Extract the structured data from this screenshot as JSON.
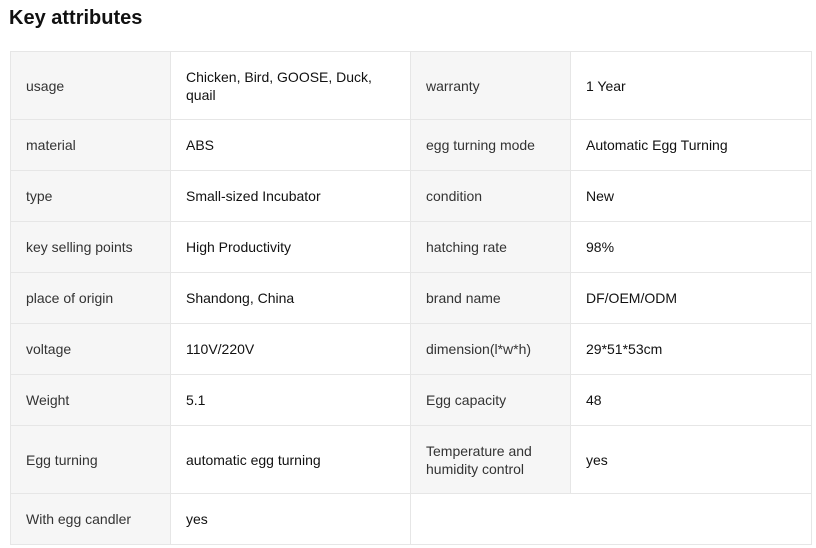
{
  "title": "Key attributes",
  "rows": [
    [
      {
        "k": "usage",
        "v": "Chicken, Bird, GOOSE, Duck, quail"
      },
      {
        "k": "warranty",
        "v": "1 Year"
      }
    ],
    [
      {
        "k": "material",
        "v": "ABS"
      },
      {
        "k": "egg turning mode",
        "v": "Automatic Egg Turning"
      }
    ],
    [
      {
        "k": "type",
        "v": "Small-sized Incubator"
      },
      {
        "k": "condition",
        "v": "New"
      }
    ],
    [
      {
        "k": "key selling points",
        "v": "High Productivity"
      },
      {
        "k": "hatching rate",
        "v": "98%"
      }
    ],
    [
      {
        "k": "place of origin",
        "v": "Shandong, China"
      },
      {
        "k": "brand name",
        "v": "DF/OEM/ODM"
      }
    ],
    [
      {
        "k": "voltage",
        "v": "110V/220V"
      },
      {
        "k": "dimension(l*w*h)",
        "v": "29*51*53cm"
      }
    ],
    [
      {
        "k": "Weight",
        "v": "5.1"
      },
      {
        "k": "Egg capacity",
        "v": "48"
      }
    ],
    [
      {
        "k": "Egg turning",
        "v": "automatic egg turning"
      },
      {
        "k": "Temperature and humidity control",
        "v": "yes"
      }
    ],
    [
      {
        "k": "With egg candler",
        "v": "yes"
      }
    ]
  ]
}
